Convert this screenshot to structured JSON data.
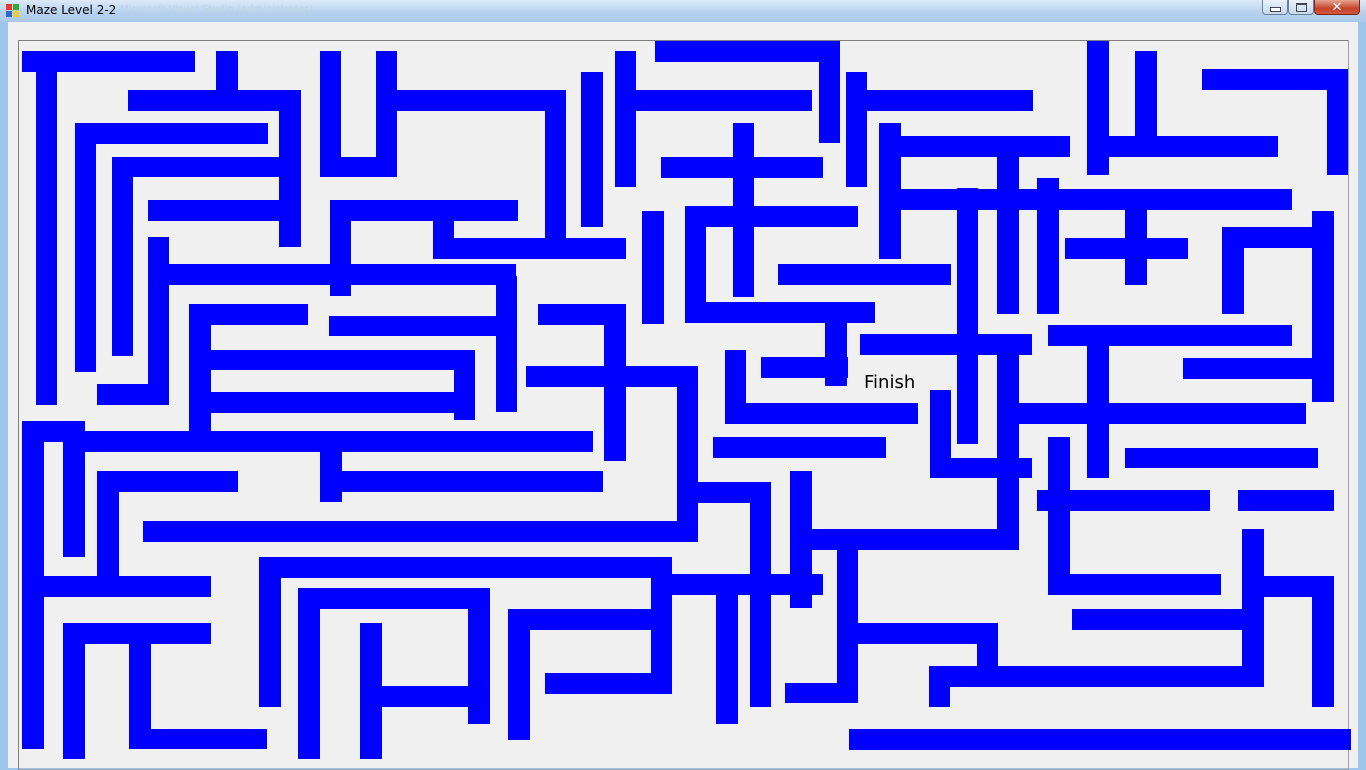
{
  "window": {
    "title": "Maze Level 2-2",
    "background_title": "Microsoft Visual Studio (Administrator)",
    "close_glyph": "✕"
  },
  "maze": {
    "wall_color": "#0000ff",
    "background_color": "#f0f0f0",
    "finish_label": "Finish"
  },
  "colors": {
    "titlebar": "#b8d3ef",
    "close_button": "#c4442b"
  }
}
